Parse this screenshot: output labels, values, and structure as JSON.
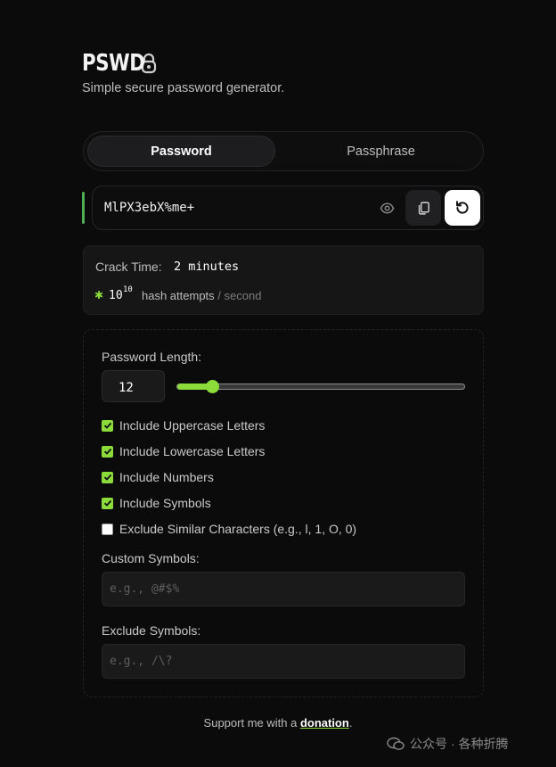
{
  "app": {
    "title": "PSWD",
    "subtitle": "Simple secure password generator."
  },
  "tabs": [
    {
      "label": "Password",
      "active": true
    },
    {
      "label": "Passphrase",
      "active": false
    }
  ],
  "password": {
    "value": "MlPX3ebX%me+"
  },
  "crack": {
    "label": "Crack Time:",
    "value": "2 minutes",
    "hash_base": "10",
    "hash_exponent": "10",
    "hash_label": "hash attempts",
    "hash_unit": "/ second"
  },
  "options": {
    "length_label": "Password Length:",
    "length_value": "12",
    "length_fraction": 0.12,
    "checkboxes": [
      {
        "label": "Include Uppercase Letters",
        "checked": true
      },
      {
        "label": "Include Lowercase Letters",
        "checked": true
      },
      {
        "label": "Include Numbers",
        "checked": true
      },
      {
        "label": "Include Symbols",
        "checked": true
      },
      {
        "label": "Exclude Similar Characters (e.g., l, 1, O, 0)",
        "checked": false
      }
    ],
    "custom_label": "Custom Symbols:",
    "custom_placeholder": "e.g., @#$%",
    "exclude_label": "Exclude Symbols:",
    "exclude_placeholder": "e.g., /\\?"
  },
  "footer": {
    "prefix": "Support me with a ",
    "link": "donation",
    "suffix": "."
  },
  "watermark": {
    "text": "公众号 · 各种折腾"
  },
  "colors": {
    "accent": "#8bdc3a",
    "bar": "#4caf50"
  }
}
